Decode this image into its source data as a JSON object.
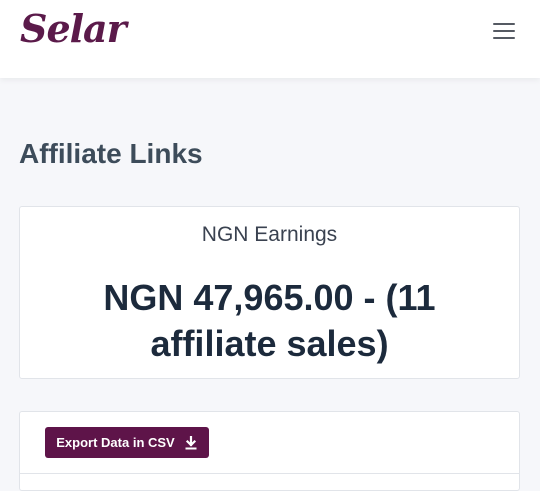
{
  "header": {
    "logo_text": "Selar",
    "menu_icon": "hamburger-menu-icon"
  },
  "page": {
    "title": "Affiliate Links"
  },
  "earnings": {
    "label": "NGN Earnings",
    "value": "NGN 47,965.00 - (11 affiliate sales)"
  },
  "actions": {
    "export_label": "Export Data in CSV",
    "export_icon": "download-icon"
  },
  "colors": {
    "brand": "#5e1449",
    "title": "#3d4c5a",
    "value": "#1c2a3c"
  }
}
